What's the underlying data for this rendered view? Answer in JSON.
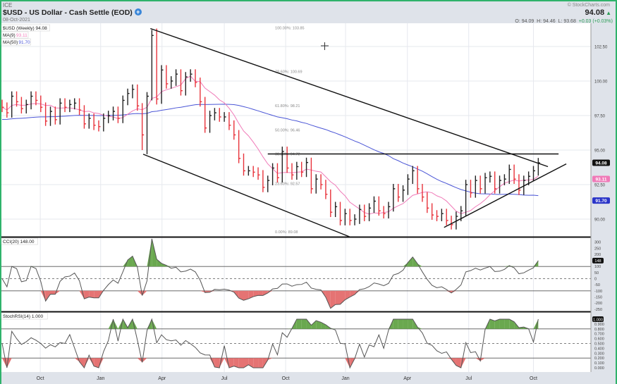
{
  "header": {
    "exchange": "ICE",
    "title": "$USD - US Dollar - Cash Settle (EOD)",
    "date": "08-Oct-2021",
    "copyright": "© StockCharts.com",
    "last": "94.08",
    "open": "O: 94.09",
    "high": "H: 94.46",
    "low": "L: 93.68",
    "change": "+0.03 (+0.03%)"
  },
  "legend": {
    "symbol": "$USD (Weekly) 94.08",
    "ma9_label": "MA(9)",
    "ma9_value": "93.11",
    "ma50_label": "MA(50)",
    "ma50_value": "91.70",
    "cci_label": "CCI(20) 148.00",
    "stochrsi_label": "StochRSI(14) 1.000"
  },
  "colors": {
    "up": "#222222",
    "down": "#e8333b",
    "ma9": "#f07ab8",
    "ma50": "#4a55d6",
    "green_fill": "#6aa84f",
    "red_fill": "#e57373"
  },
  "chart_data": {
    "type": "ohlc",
    "period": "weekly",
    "closes": [
      98.1,
      97.7,
      98.9,
      98.5,
      98.0,
      98.3,
      98.9,
      98.6,
      98.1,
      97.1,
      97.8,
      97.2,
      98.4,
      98.1,
      98.3,
      98.4,
      97.9,
      96.9,
      97.3,
      96.8,
      96.7,
      97.3,
      97.5,
      97.8,
      97.3,
      98.6,
      99.1,
      99.4,
      98.2,
      96.1,
      98.9,
      103.3,
      98.7,
      100.8,
      99.8,
      100.0,
      100.5,
      99.3,
      100.3,
      100.5,
      99.9,
      98.5,
      96.6,
      97.5,
      97.7,
      97.4,
      97.4,
      96.8,
      96.1,
      94.4,
      93.5,
      93.5,
      93.4,
      93.2,
      92.3,
      92.8,
      93.7,
      93.0,
      94.9,
      93.7,
      93.2,
      93.8,
      93.4,
      94.1,
      92.2,
      92.9,
      92.5,
      91.8,
      90.5,
      90.9,
      89.9,
      90.4,
      89.9,
      90.0,
      90.7,
      90.2,
      90.8,
      91.3,
      90.6,
      90.4,
      90.9,
      92.2,
      91.6,
      92.1,
      92.9,
      93.5,
      92.2,
      91.6,
      90.8,
      90.3,
      90.2,
      90.4,
      89.9,
      89.6,
      90.2,
      90.6,
      92.5,
      91.9,
      92.8,
      92.2,
      93.0,
      93.1,
      92.2,
      92.8,
      92.9,
      93.6,
      92.9,
      92.1,
      92.8,
      93.1,
      93.5,
      94.08
    ],
    "extremes": {
      "29": [
        98.4,
        95.0
      ],
      "30": [
        99.2,
        94.7
      ],
      "31": [
        103.7,
        98.6
      ],
      "32": [
        103.8,
        98.3
      ]
    },
    "y_ticks": [
      "102.50",
      "100.00",
      "97.50",
      "95.00",
      "92.50",
      "90.00"
    ],
    "x_ticks": [
      {
        "label": "Oct",
        "bar": 7.9
      },
      {
        "label": "Jan",
        "bar": 20.4
      },
      {
        "label": "Apr",
        "bar": 33.1
      },
      {
        "label": "Jul",
        "bar": 46
      },
      {
        "label": "Oct",
        "bar": 58.7
      },
      {
        "label": "Jan",
        "bar": 71.1
      },
      {
        "label": "Apr",
        "bar": 83.9
      },
      {
        "label": "Jul",
        "bar": 96.6
      },
      {
        "label": "Oct",
        "bar": 110
      }
    ],
    "moving_averages": [
      {
        "name": "MA(9)",
        "period": 9,
        "last": 93.11
      },
      {
        "name": "MA(50)",
        "period": 50,
        "last": 91.7
      }
    ],
    "fibonacci": [
      {
        "label": "100.00%: 103.85",
        "price": 103.85
      },
      {
        "label": "78.60%: 100.69",
        "price": 100.69
      },
      {
        "label": "61.80%: 98.21",
        "price": 98.21
      },
      {
        "label": "50.00%: 96.46",
        "price": 96.46
      },
      {
        "label": "38.20%: 94.72",
        "price": 94.72
      },
      {
        "label": "23.60%: 92.57",
        "price": 92.57
      },
      {
        "label": "0.00%: 89.08",
        "price": 89.08
      }
    ],
    "trendlines": [
      [
        [
          30.7,
          103.8
        ],
        [
          113,
          93.8
        ]
      ],
      [
        [
          29.2,
          94.7
        ],
        [
          72.1,
          88.7
        ]
      ],
      [
        [
          55,
          94.72
        ],
        [
          115.2,
          94.72
        ]
      ],
      [
        [
          91.5,
          89.4
        ],
        [
          116.8,
          94.0
        ]
      ]
    ],
    "cci": {
      "period": 20,
      "last": "148",
      "ticks": [
        "300",
        "250",
        "200",
        "150",
        "100",
        "50",
        "0",
        "-50",
        "-100",
        "-150",
        "-200",
        "-250"
      ],
      "levels": [
        100,
        0,
        -100
      ]
    },
    "stochrsi": {
      "period": 14,
      "last": "1.000",
      "ticks": [
        "0.900",
        "0.800",
        "0.700",
        "0.600",
        "0.500",
        "0.400",
        "0.300",
        "0.200",
        "0.100",
        "0.000"
      ],
      "levels": [
        0.8,
        0.5,
        0.2
      ]
    }
  }
}
